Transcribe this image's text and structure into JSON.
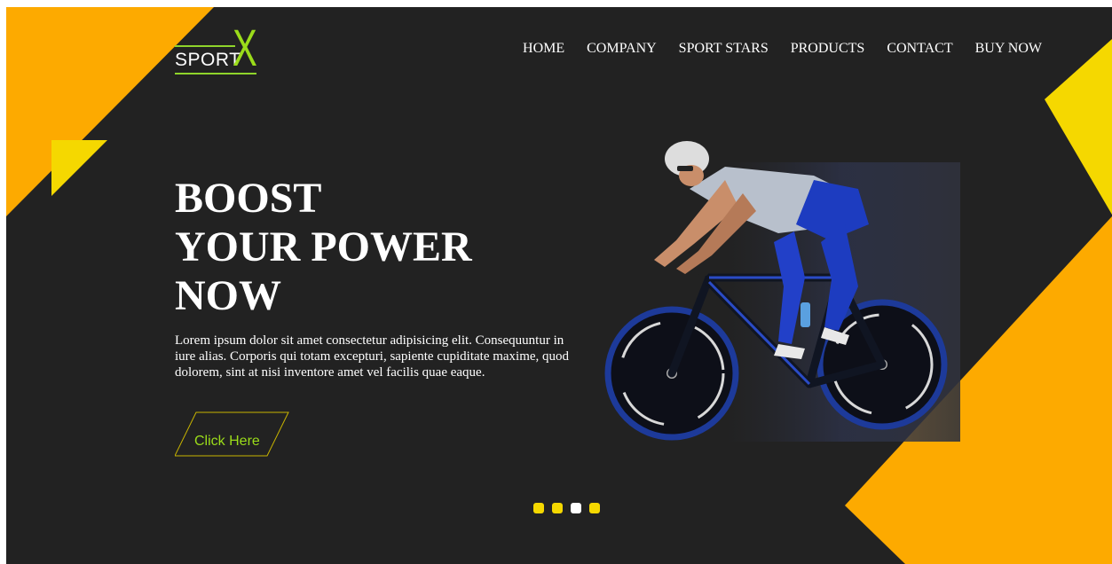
{
  "brand": {
    "word": "SPORT",
    "mark": "X"
  },
  "nav": {
    "items": [
      {
        "label": "HOME"
      },
      {
        "label": "COMPANY"
      },
      {
        "label": "SPORT STARS"
      },
      {
        "label": "PRODUCTS"
      },
      {
        "label": "CONTACT"
      },
      {
        "label": "BUY NOW"
      }
    ]
  },
  "hero": {
    "title_lines": [
      "BOOST",
      "YOUR POWER",
      "NOW"
    ],
    "description": "Lorem ipsum dolor sit amet consectetur adipisicing elit. Consequuntur in iure alias. Corporis qui totam excepturi, sapiente cupiditate maxime, quod dolorem, sint at nisi inventore amet vel facilis quae eaque.",
    "cta_label": "Click Here",
    "image": "cyclist-racing-bike"
  },
  "slider": {
    "dots": [
      {
        "color": "#f5d800"
      },
      {
        "color": "#f5d800"
      },
      {
        "color": "#ffffff"
      },
      {
        "color": "#f5d800"
      }
    ]
  },
  "colors": {
    "background": "#222222",
    "accent_orange": "#fdaa00",
    "accent_yellow": "#f5d800",
    "logo_green": "#9bdc1a"
  }
}
